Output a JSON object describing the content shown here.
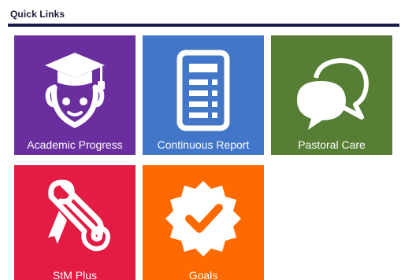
{
  "header": {
    "title": "Quick Links"
  },
  "tiles": [
    {
      "label": "Academic Progress",
      "icon": "graduation-student-icon",
      "color": "#6b2e9f"
    },
    {
      "label": "Continuous Report",
      "icon": "report-document-icon",
      "color": "#4276c9"
    },
    {
      "label": "Pastoral Care",
      "icon": "speech-bubbles-icon",
      "color": "#567e34"
    },
    {
      "label": "StM Plus",
      "icon": "diploma-scroll-icon",
      "color": "#e41b43"
    },
    {
      "label": "Goals",
      "icon": "check-badge-icon",
      "color": "#ff6a00"
    }
  ],
  "colors": {
    "header_rule": "#1a1a4d",
    "header_text": "#1b1b3a"
  }
}
